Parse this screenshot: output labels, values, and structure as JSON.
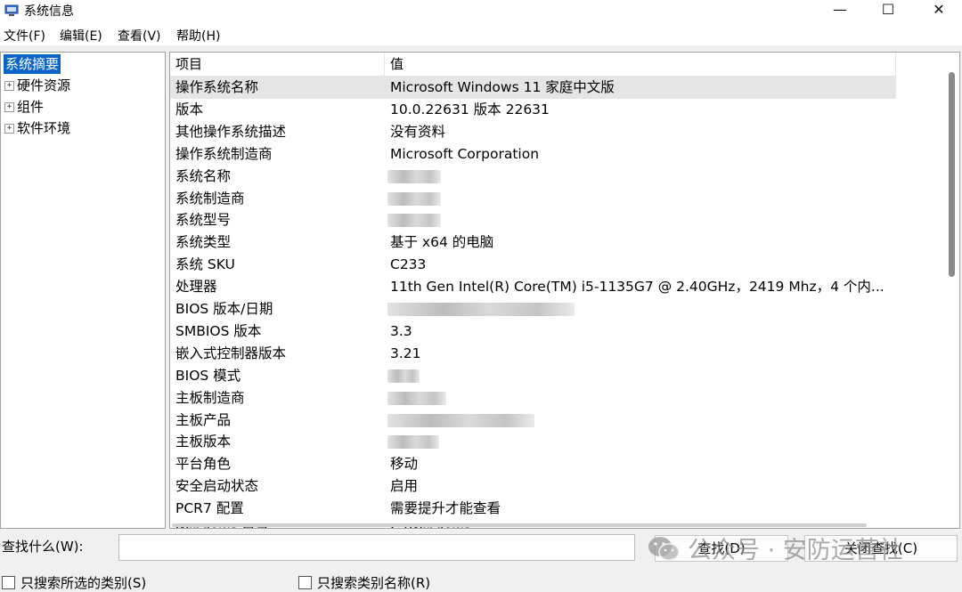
{
  "window": {
    "title": "系统信息",
    "icons": {
      "app": "system-info-icon",
      "minimize": "minimize-icon",
      "maximize": "maximize-icon",
      "close": "close-icon"
    },
    "minimize_glyph": "—",
    "maximize_glyph": "☐",
    "close_glyph": "✕"
  },
  "menu": [
    "文件(F)",
    "编辑(E)",
    "查看(V)",
    "帮助(H)"
  ],
  "tree": {
    "expander_glyph": "+",
    "items": [
      {
        "label": "系统摘要",
        "selected": true
      },
      {
        "label": "硬件资源",
        "expandable": true
      },
      {
        "label": "组件",
        "expandable": true
      },
      {
        "label": "软件环境",
        "expandable": true
      }
    ]
  },
  "table": {
    "headers": [
      "项目",
      "值"
    ],
    "rows": [
      {
        "key": "操作系统名称",
        "value": "Microsoft Windows 11 家庭中文版",
        "selected": true
      },
      {
        "key": "版本",
        "value": "10.0.22631 版本 22631"
      },
      {
        "key": "其他操作系统描述",
        "value": "没有资料"
      },
      {
        "key": "操作系统制造商",
        "value": "Microsoft Corporation"
      },
      {
        "key": "系统名称",
        "value": "",
        "redacted": true
      },
      {
        "key": "系统制造商",
        "value": "",
        "redacted": true
      },
      {
        "key": "系统型号",
        "value": "",
        "redacted": true
      },
      {
        "key": "系统类型",
        "value": "基于 x64 的电脑"
      },
      {
        "key": "系统 SKU",
        "value": "C233"
      },
      {
        "key": "处理器",
        "value": "11th Gen Intel(R) Core(TM) i5-1135G7 @ 2.40GHz，2419 Mhz，4 个内..."
      },
      {
        "key": "BIOS 版本/日期",
        "value": "",
        "redacted": true
      },
      {
        "key": "SMBIOS 版本",
        "value": "3.3"
      },
      {
        "key": "嵌入式控制器版本",
        "value": "3.21"
      },
      {
        "key": "BIOS 模式",
        "value": "",
        "redacted": true
      },
      {
        "key": "主板制造商",
        "value": "",
        "redacted": true
      },
      {
        "key": "主板产品",
        "value": "",
        "redacted": true
      },
      {
        "key": "主板版本",
        "value": "",
        "redacted": true
      },
      {
        "key": "平台角色",
        "value": "移动"
      },
      {
        "key": "安全启动状态",
        "value": "启用"
      },
      {
        "key": "PCR7 配置",
        "value": "需要提升才能查看"
      },
      {
        "key": "Windows 目录",
        "value": "C:\\Windows"
      }
    ]
  },
  "find": {
    "label": "查找什么(W):",
    "value": "",
    "find_button": "查找(D)",
    "close_find_button": "关闭查找(C)",
    "checkbox_selected_category": "只搜索所选的类别(S)",
    "checkbox_category_names": "只搜索类别名称(R)"
  },
  "watermark": {
    "text": "公众号 · 安防运营社",
    "icon": "wechat-icon"
  }
}
